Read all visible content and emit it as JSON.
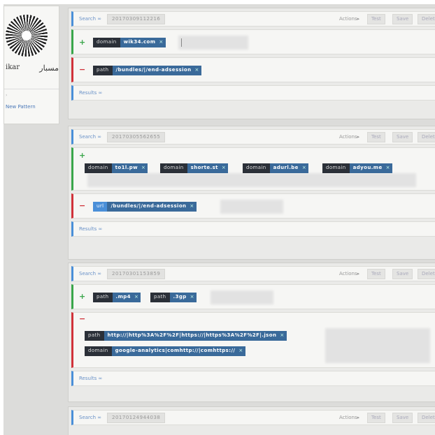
{
  "sidebar": {
    "logo_latin": "ikar",
    "logo_arabic": "مسبار",
    "new_pattern_label": "New Pattern"
  },
  "labels": {
    "search": "Search ∞",
    "actions": "Actions▸",
    "test": "Test",
    "save": "Save",
    "delete": "Delet",
    "results": "Results ∞"
  },
  "patterns": [
    {
      "search_id": "20170309112216",
      "add": [
        {
          "key": "domain",
          "value": "wik34.com"
        }
      ],
      "remove": [
        {
          "key": "path",
          "value": "/bundles/|/end-adsession"
        }
      ]
    },
    {
      "search_id": "20170305562655",
      "add": [
        {
          "key": "domain",
          "value": "to1l.pw"
        },
        {
          "key": "domain",
          "value": "shorte.st"
        },
        {
          "key": "domain",
          "value": "adurl.be"
        },
        {
          "key": "domain",
          "value": "adyou.me"
        }
      ],
      "remove": [
        {
          "key": "url",
          "value": "/bundles/|/end-adsession"
        }
      ]
    },
    {
      "search_id": "20170301153859",
      "add": [
        {
          "key": "path",
          "value": ".mp4"
        },
        {
          "key": "path",
          "value": ".3gp"
        }
      ],
      "remove": [
        {
          "key": "path",
          "value": "http://|http%3A%2F%2F|https://|https%3A%2F%2F|.json"
        },
        {
          "key": "domain",
          "value": "google-analytics|comhttp://|comhttps://"
        }
      ]
    },
    {
      "search_id": "20170124944038"
    }
  ]
}
